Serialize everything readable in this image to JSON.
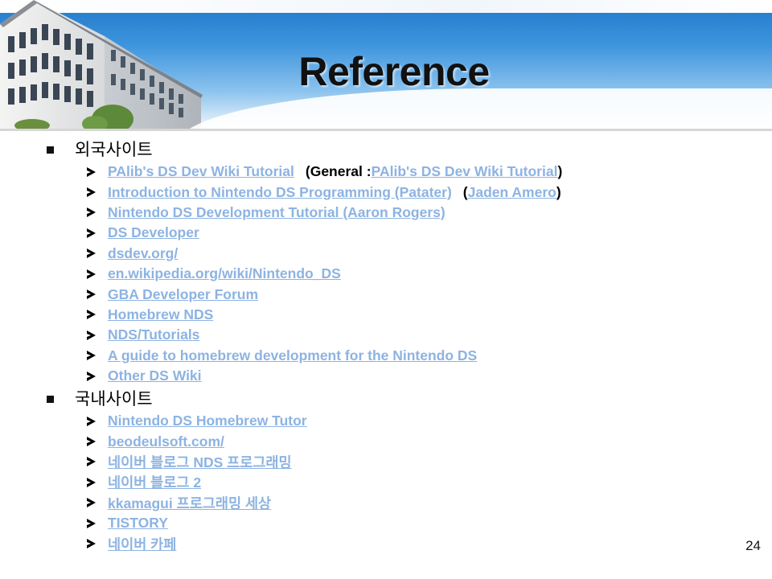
{
  "slide": {
    "title": "Reference",
    "page_number": "24"
  },
  "sections": [
    {
      "heading": "외국사이트",
      "items": [
        {
          "parts": [
            {
              "text": "PAlib's DS Dev Wiki Tutorial",
              "link": true
            },
            {
              "text": "(General : ",
              "link": false
            },
            {
              "text": "PAlib's DS Dev Wiki Tutorial",
              "link": true
            },
            {
              "text": ")",
              "link": false
            }
          ]
        },
        {
          "parts": [
            {
              "text": "Introduction to Nintendo DS Programming (Patater)",
              "link": true
            },
            {
              "text": "(",
              "link": false
            },
            {
              "text": "Jaden Amero",
              "link": true
            },
            {
              "text": ")",
              "link": false
            }
          ]
        },
        {
          "parts": [
            {
              "text": "Nintendo DS Development Tutorial (Aaron Rogers)",
              "link": true
            }
          ]
        },
        {
          "parts": [
            {
              "text": "DS Developer",
              "link": true
            }
          ]
        },
        {
          "parts": [
            {
              "text": "dsdev.org/",
              "link": true
            }
          ]
        },
        {
          "parts": [
            {
              "text": "en.wikipedia.org/wiki/Nintendo_DS",
              "link": true
            }
          ]
        },
        {
          "parts": [
            {
              "text": "GBA Developer Forum",
              "link": true
            }
          ]
        },
        {
          "parts": [
            {
              "text": "Homebrew NDS",
              "link": true
            }
          ]
        },
        {
          "parts": [
            {
              "text": "NDS/Tutorials",
              "link": true
            }
          ]
        },
        {
          "parts": [
            {
              "text": "A guide to homebrew development for the Nintendo DS",
              "link": true
            }
          ]
        },
        {
          "parts": [
            {
              "text": "Other DS Wiki",
              "link": true
            }
          ]
        }
      ]
    },
    {
      "heading": "국내사이트",
      "items": [
        {
          "parts": [
            {
              "text": "Nintendo DS Homebrew Tutor",
              "link": true
            }
          ]
        },
        {
          "parts": [
            {
              "text": "beodeulsoft.com/",
              "link": true
            }
          ]
        },
        {
          "parts": [
            {
              "text": "네이버 블로그 NDS 프로그래밍",
              "link": true
            }
          ]
        },
        {
          "parts": [
            {
              "text": "네이버 블로그 2",
              "link": true
            }
          ]
        },
        {
          "parts": [
            {
              "text": "kkamagui 프로그래밍 세상",
              "link": true
            }
          ]
        },
        {
          "parts": [
            {
              "text": "TISTORY",
              "link": true
            }
          ]
        },
        {
          "parts": [
            {
              "text": "네이버 카페",
              "link": true
            }
          ]
        }
      ]
    }
  ],
  "colors": {
    "link": "#8db3e2",
    "banner_sky": "#3e95dd",
    "title": "#111111"
  },
  "icons": {
    "section_bullet": "square-bullet-icon",
    "item_bullet": "arrow-bullet-icon"
  }
}
